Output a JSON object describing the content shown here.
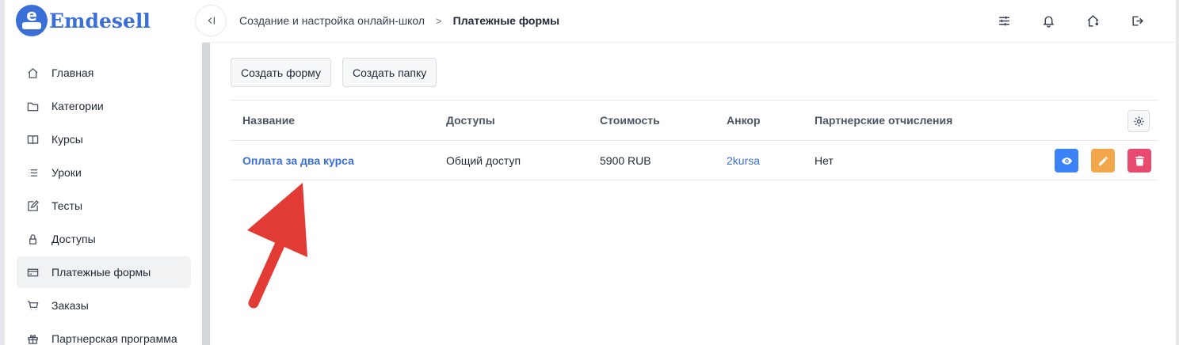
{
  "brand": {
    "name": "Emdesell",
    "mark_letter": "e",
    "color": "#3b6fd8"
  },
  "sidebar": {
    "items": [
      {
        "label": "Главная",
        "icon": "home-icon",
        "active": false
      },
      {
        "label": "Категории",
        "icon": "folder-icon",
        "active": false
      },
      {
        "label": "Курсы",
        "icon": "book-icon",
        "active": false
      },
      {
        "label": "Уроки",
        "icon": "list-icon",
        "active": false
      },
      {
        "label": "Тесты",
        "icon": "edit-icon",
        "active": false
      },
      {
        "label": "Доступы",
        "icon": "lock-icon",
        "active": false
      },
      {
        "label": "Платежные формы",
        "icon": "credit-card-icon",
        "active": true
      },
      {
        "label": "Заказы",
        "icon": "cart-icon",
        "active": false
      },
      {
        "label": "Партнерская программа",
        "icon": "gift-icon",
        "active": false
      }
    ]
  },
  "header": {
    "breadcrumb": [
      "Создание и настройка онлайн-школ",
      "Платежные формы"
    ],
    "breadcrumb_separator": ">",
    "icons": [
      "sliders-icon",
      "bell-icon",
      "home-settings-icon",
      "logout-icon"
    ]
  },
  "toolbar": {
    "create_form": "Создать форму",
    "create_folder": "Создать папку"
  },
  "table": {
    "columns": [
      "Название",
      "Доступы",
      "Стоимость",
      "Анкор",
      "Партнерские отчисления"
    ],
    "rows": [
      {
        "name": "Оплата за два курса",
        "access": "Общий доступ",
        "price": "5900 RUB",
        "anchor": "2kursa",
        "affiliate": "Нет"
      }
    ]
  },
  "colors": {
    "accent": "#3b6fd8",
    "view": "#3b82f6",
    "edit": "#f2a84a",
    "delete": "#e84a6f",
    "annotation_arrow": "#e23a34"
  }
}
